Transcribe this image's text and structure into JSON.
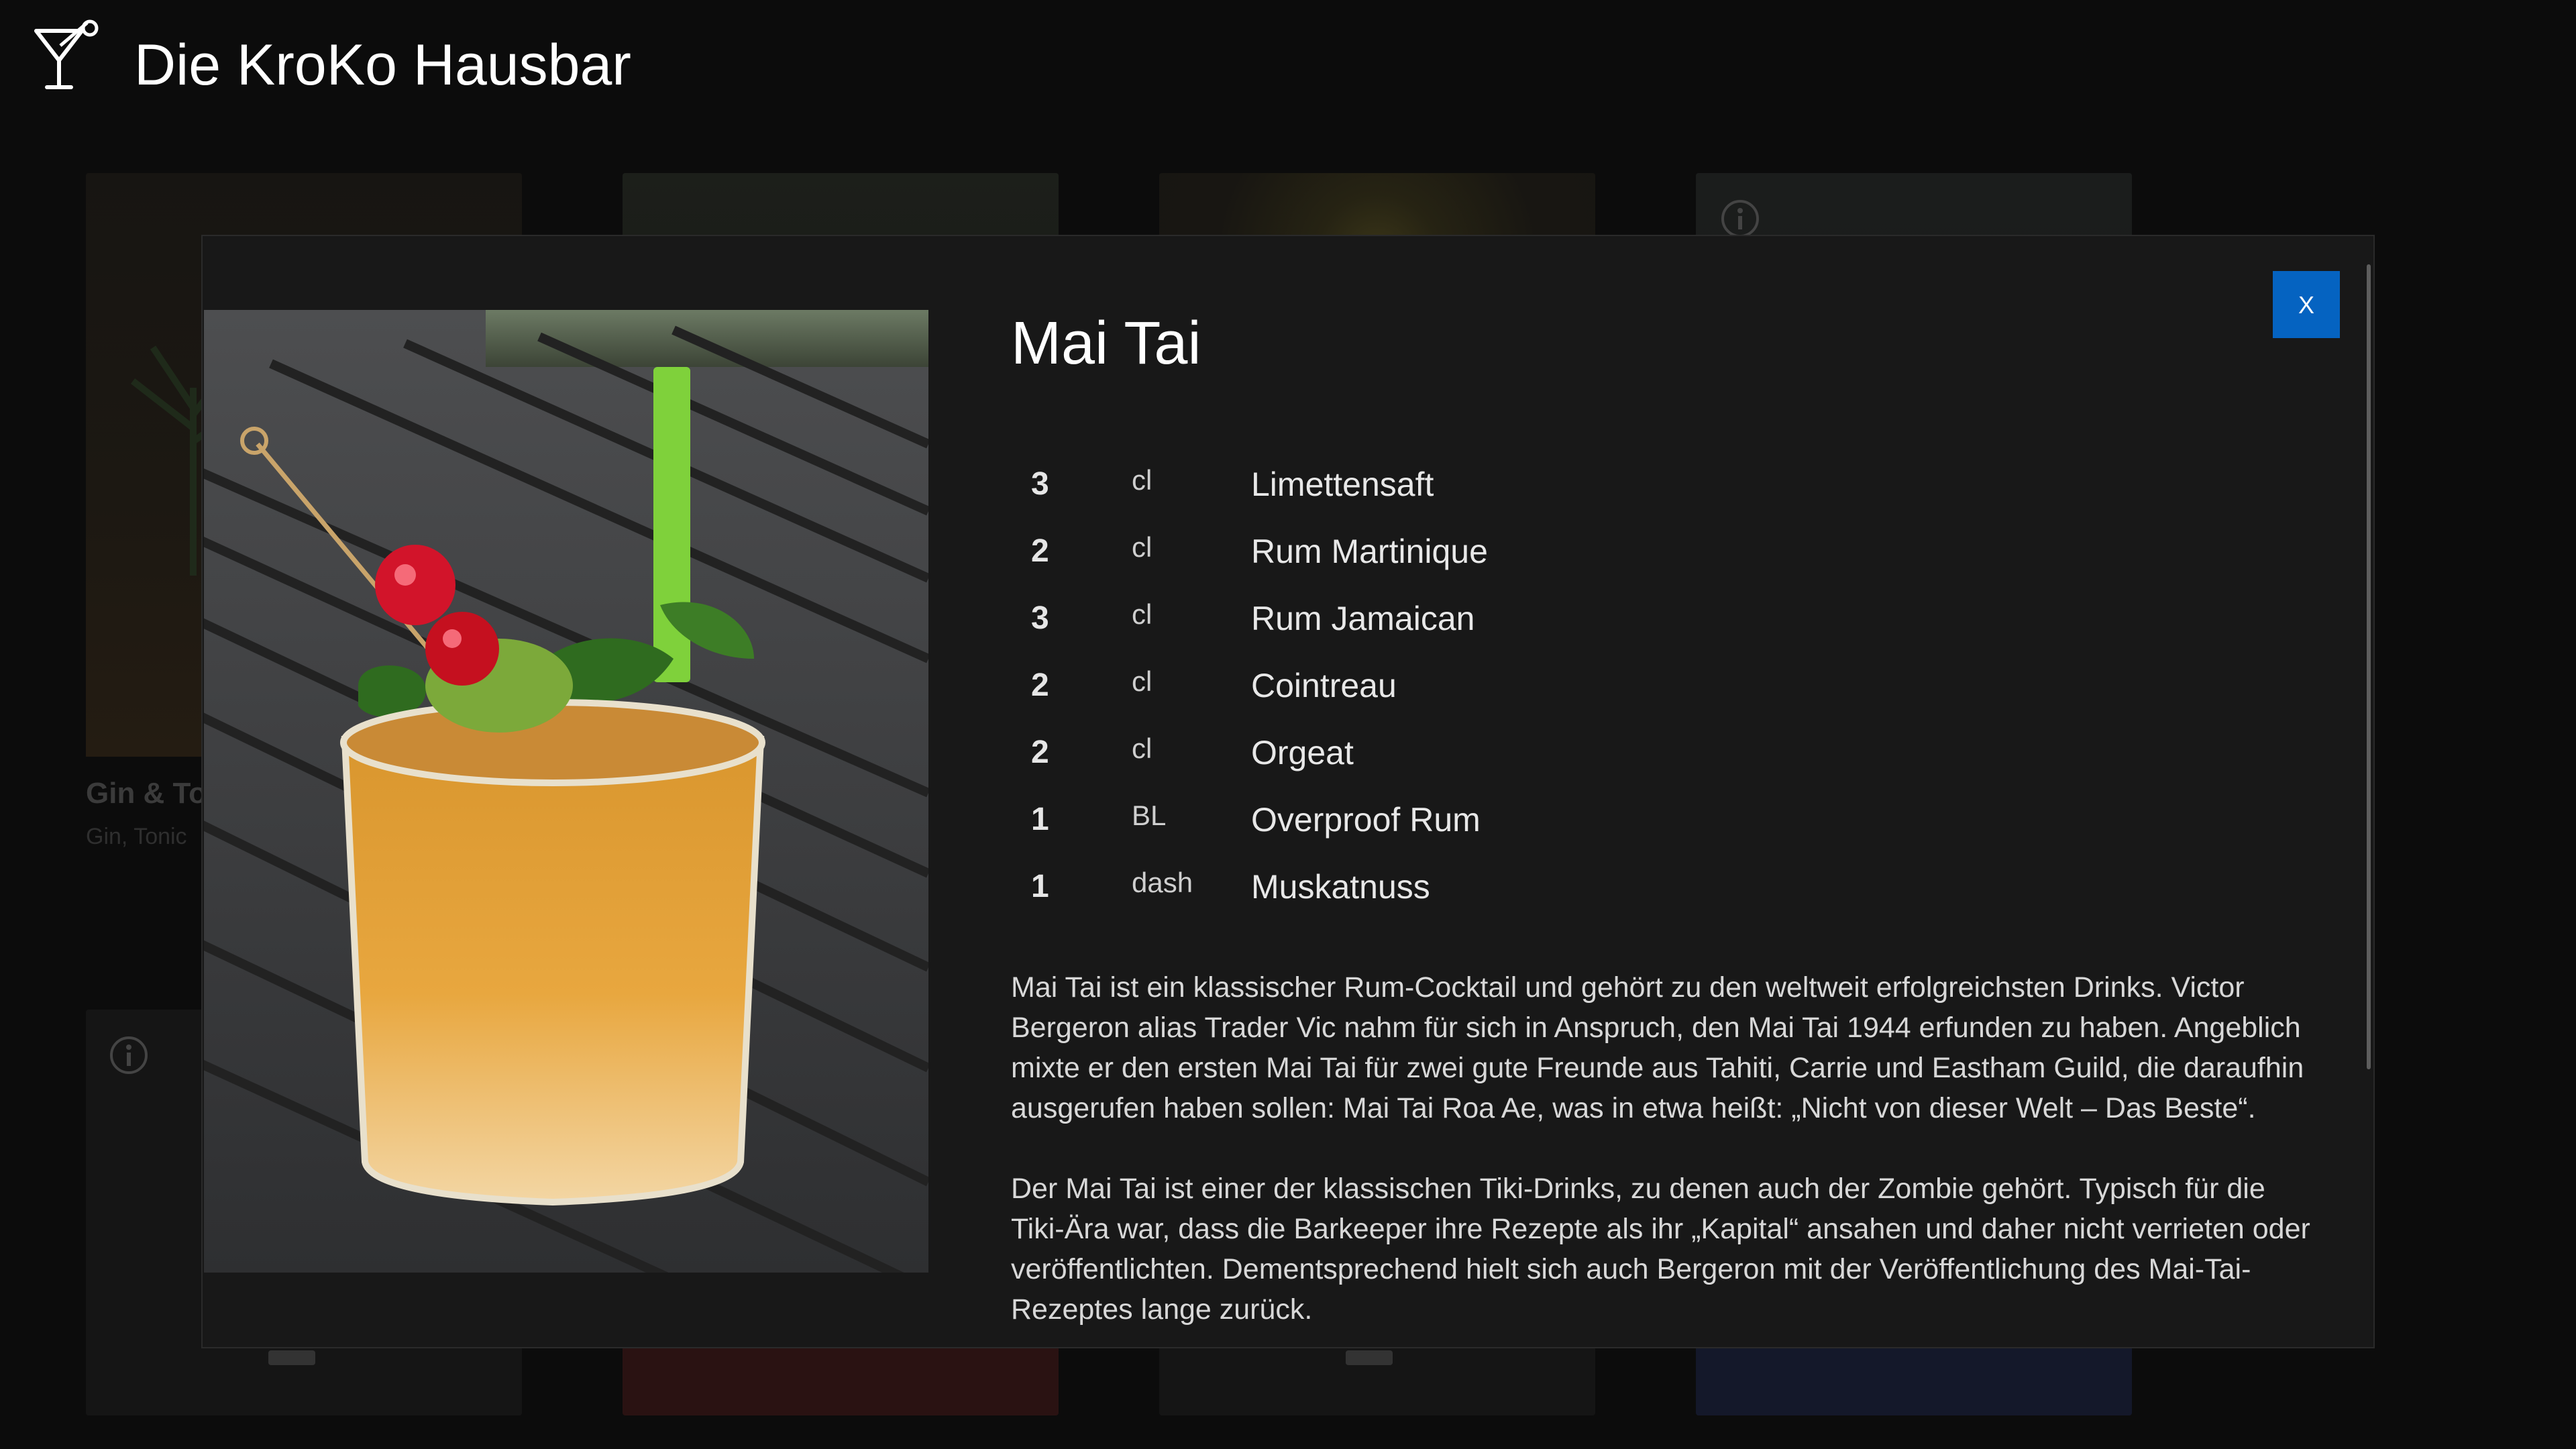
{
  "app": {
    "title": "Die KroKo Hausbar",
    "logo_icon": "cocktail-glass-icon"
  },
  "background_cards": [
    {
      "title": "Gin & To",
      "subtitle": "Gin, Tonic"
    }
  ],
  "modal": {
    "title": "Mai Tai",
    "close_label": "X",
    "image_alt": "Mai Tai",
    "ingredients": [
      {
        "amount": "3",
        "unit": "cl",
        "name": "Limettensaft"
      },
      {
        "amount": "2",
        "unit": "cl",
        "name": "Rum Martinique"
      },
      {
        "amount": "3",
        "unit": "cl",
        "name": "Rum Jamaican"
      },
      {
        "amount": "2",
        "unit": "cl",
        "name": "Cointreau"
      },
      {
        "amount": "2",
        "unit": "cl",
        "name": "Orgeat"
      },
      {
        "amount": "1",
        "unit": "BL",
        "name": "Overproof Rum"
      },
      {
        "amount": "1",
        "unit": "dash",
        "name": "Muskatnuss"
      }
    ],
    "description": [
      "Mai Tai ist ein klassischer Rum-Cocktail und gehört zu den weltweit erfolgreichsten Drinks. Victor Bergeron alias Trader Vic nahm für sich in Anspruch, den Mai Tai 1944 erfunden zu haben. Angeblich mixte er den ersten Mai Tai für zwei gute Freunde aus Tahiti, Carrie und Eastham Guild, die daraufhin ausgerufen haben sollen: Mai Tai Roa Ae, was in etwa heißt: „Nicht von dieser Welt – Das Beste“.",
      "Der Mai Tai ist einer der klassischen Tiki-Drinks, zu denen auch der Zombie gehört. Typisch für die Tiki-Ära war, dass die Barkeeper ihre Rezepte als ihr „Kapital“ ansahen und daher nicht verrieten oder veröffentlichten. Dementsprechend hielt sich auch Bergeron mit der Veröffentlichung des Mai-Tai-Rezeptes lange zurück."
    ]
  },
  "colors": {
    "background": "#0c0c0c",
    "modal": "#181818",
    "accent": "#0563c1"
  }
}
